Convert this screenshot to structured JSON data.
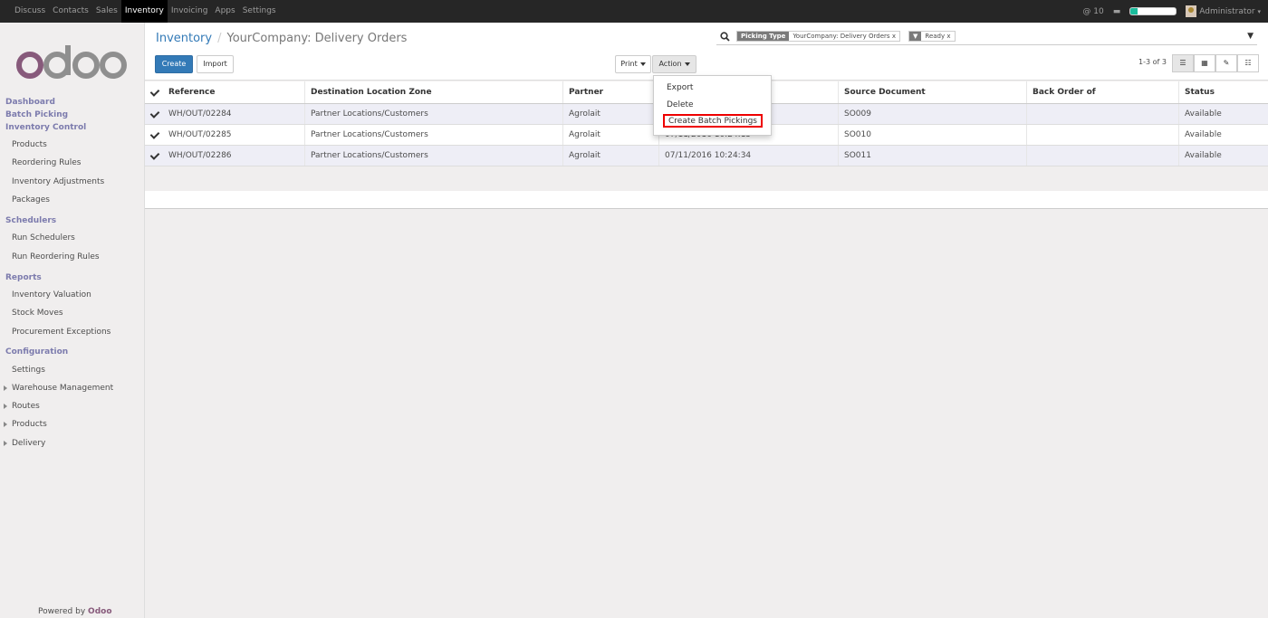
{
  "topbar": {
    "menu": [
      "Discuss",
      "Contacts",
      "Sales",
      "Inventory",
      "Invoicing",
      "Apps",
      "Settings"
    ],
    "active": "Inventory",
    "notifications": "10",
    "user": "Administrator",
    "progress": 0.15
  },
  "sidebar": {
    "logo": "odoo",
    "items": [
      {
        "label": "Dashboard",
        "kind": "h"
      },
      {
        "label": "Batch Picking",
        "kind": "h"
      },
      {
        "label": "Inventory Control",
        "kind": "h"
      },
      {
        "label": "Products",
        "kind": "i"
      },
      {
        "label": "Reordering Rules",
        "kind": "i"
      },
      {
        "label": "Inventory Adjustments",
        "kind": "i"
      },
      {
        "label": "Packages",
        "kind": "i"
      },
      {
        "label": "Schedulers",
        "kind": "h"
      },
      {
        "label": "Run Schedulers",
        "kind": "i"
      },
      {
        "label": "Run Reordering Rules",
        "kind": "i"
      },
      {
        "label": "Reports",
        "kind": "h"
      },
      {
        "label": "Inventory Valuation",
        "kind": "i"
      },
      {
        "label": "Stock Moves",
        "kind": "i"
      },
      {
        "label": "Procurement Exceptions",
        "kind": "i"
      },
      {
        "label": "Configuration",
        "kind": "h"
      },
      {
        "label": "Settings",
        "kind": "i"
      },
      {
        "label": "Warehouse Management",
        "kind": "c"
      },
      {
        "label": "Routes",
        "kind": "c"
      },
      {
        "label": "Products",
        "kind": "c"
      },
      {
        "label": "Delivery",
        "kind": "c"
      }
    ],
    "powered_prefix": "Powered by",
    "powered_brand": "Odoo"
  },
  "breadcrumb": {
    "parent": "Inventory",
    "current": "YourCompany: Delivery Orders"
  },
  "buttons": {
    "create": "Create",
    "import": "Import",
    "print": "Print",
    "action": "Action"
  },
  "search": {
    "facet1_label": "Picking Type",
    "facet1_value": "YourCompany: Delivery Orders",
    "facet2_value": "Ready",
    "remove": "x"
  },
  "pager": "1-3 of 3",
  "table": {
    "headers": [
      "Reference",
      "Destination Location Zone",
      "Partner",
      "",
      "Source Document",
      "Back Order of",
      "Status"
    ],
    "rows": [
      [
        "WH/OUT/02284",
        "Partner Locations/Customers",
        "Agrolait",
        "",
        "SO009",
        "",
        "Available"
      ],
      [
        "WH/OUT/02285",
        "Partner Locations/Customers",
        "Agrolait",
        "07/11/2016 10:24:15",
        "SO010",
        "",
        "Available"
      ],
      [
        "WH/OUT/02286",
        "Partner Locations/Customers",
        "Agrolait",
        "07/11/2016 10:24:34",
        "SO011",
        "",
        "Available"
      ]
    ]
  },
  "action_menu": [
    "Export",
    "Delete",
    "Create Batch Pickings"
  ],
  "colors": {
    "accent": "#337ab7",
    "brand": "#875a7b",
    "highlight": "#e00000"
  }
}
